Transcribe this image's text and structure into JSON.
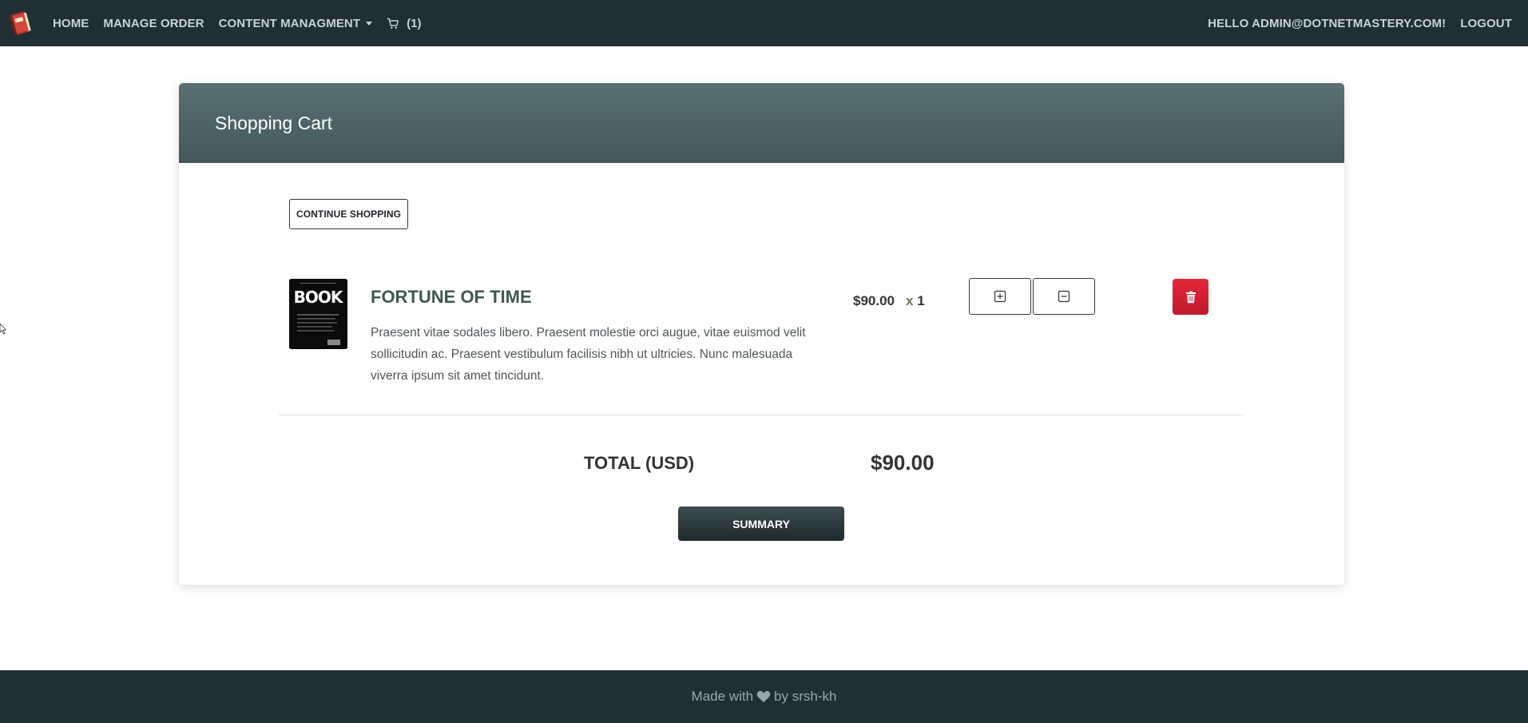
{
  "navbar": {
    "home_label": "HOME",
    "manage_order_label": "MANAGE ORDER",
    "content_management_label": "CONTENT MANAGMENT",
    "cart_count": "(1)",
    "greeting": "HELLO ADMIN@DOTNETMASTERY.COM!",
    "logout_label": "LOGOUT"
  },
  "card": {
    "title": "Shopping Cart",
    "continue_label": "CONTINUE SHOPPING"
  },
  "item": {
    "title": "FORTUNE OF TIME",
    "description": "Praesent vitae sodales libero. Praesent molestie orci augue, vitae euismod velit sollicitudin ac. Praesent vestibulum facilisis nibh ut ultricies. Nunc malesuada viverra ipsum sit amet tincidunt.",
    "price": "$90.00",
    "qty_x": "x",
    "qty": "1",
    "cover_text": "BOOK"
  },
  "totals": {
    "label": "TOTAL (USD)",
    "value": "$90.00"
  },
  "summary_label": "SUMMARY",
  "footer": {
    "made_with": "Made with",
    "by": "by srsh-kh"
  },
  "colors": {
    "navbar_bg": "#1f2f33",
    "header_bg": "#51676b",
    "title_green": "#3e5a4d",
    "delete_red": "#d42033"
  },
  "icons": [
    "book-logo-icon",
    "chevron-down-icon",
    "cart-icon",
    "plus-square-icon",
    "minus-square-icon",
    "trash-icon",
    "heart-icon",
    "mouse-cursor-icon"
  ]
}
